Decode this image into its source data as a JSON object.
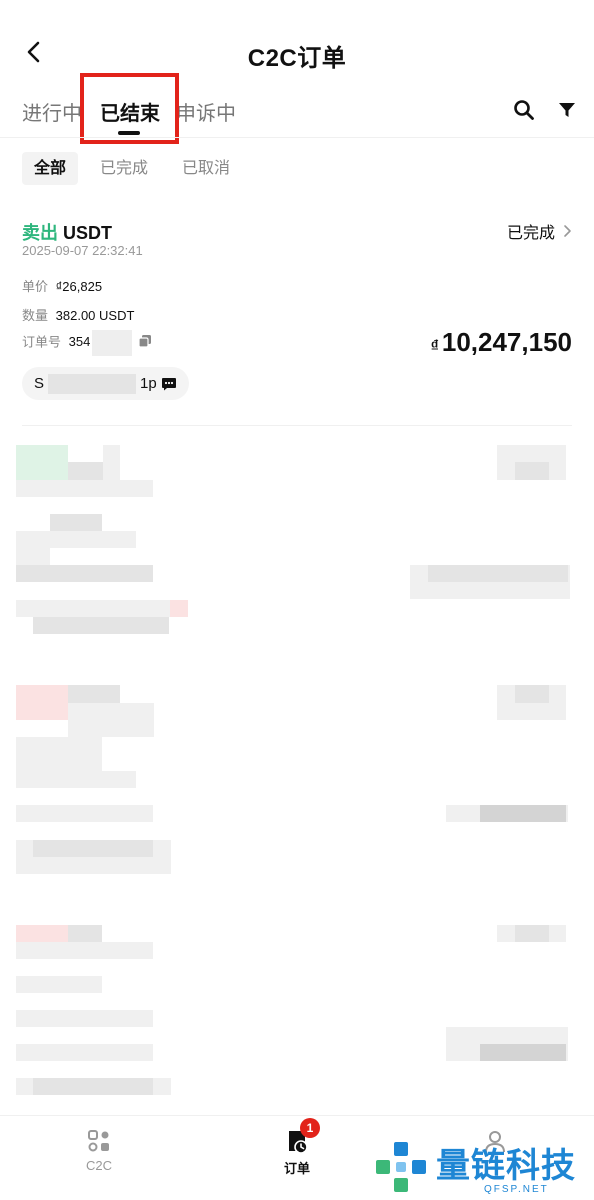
{
  "header": {
    "title": "C2C订单"
  },
  "tabs": [
    {
      "label": "进行中"
    },
    {
      "label": "已结束"
    },
    {
      "label": "申诉中"
    }
  ],
  "filters": [
    {
      "label": "全部"
    },
    {
      "label": "已完成"
    },
    {
      "label": "已取消"
    }
  ],
  "order": {
    "side_label": "卖出",
    "asset": "USDT",
    "datetime": "2025-09-07 22:32:41",
    "status": "已完成",
    "price_label": "单价",
    "price_value": "₫26,825",
    "qty_label": "数量",
    "qty_value": "382.00 USDT",
    "orderno_label": "订单号",
    "orderno_value": "354",
    "amount_currency": "₫",
    "amount_value": "10,247,150",
    "merchant_prefix": "S",
    "merchant_suffix": "1p"
  },
  "tabbar": [
    {
      "label": "C2C"
    },
    {
      "label": "订单",
      "badge": "1"
    }
  ],
  "watermark": {
    "text": "量链科技",
    "sub": "QFSP.NET"
  },
  "colors": {
    "accent_red": "#e2231a",
    "buy_green": "#2eb67d",
    "watermark_blue": "#1e86d4"
  }
}
